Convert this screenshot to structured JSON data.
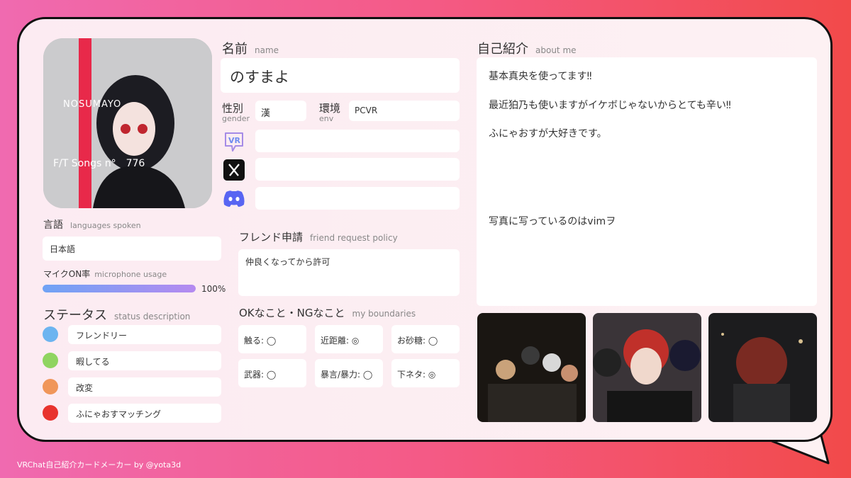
{
  "profile": {
    "name_label": "名前",
    "name_sub": "name",
    "name_value": "のすまよ",
    "gender_label": "性別",
    "gender_sub": "gender",
    "gender_value": "漢",
    "env_label": "環境",
    "env_sub": "env",
    "env_value": "PCVR",
    "avatar_caption_top": "NOSUMAYO",
    "avatar_caption_bottom": "F/T Songs n°　776"
  },
  "social": {
    "vrchat_icon": "vrchat-icon",
    "x_icon": "x-icon",
    "discord_icon": "discord-icon",
    "vrchat_value": "",
    "x_value": "",
    "discord_value": ""
  },
  "languages": {
    "label": "言語",
    "sub": "languages spoken",
    "value": "日本語"
  },
  "mic": {
    "label": "マイクON率",
    "sub": "microphone usage",
    "percent": 100,
    "percent_text": "100%"
  },
  "status": {
    "label": "ステータス",
    "sub": "status description",
    "items": [
      {
        "color": "#6cb4f0",
        "text": "フレンドリー"
      },
      {
        "color": "#8fd460",
        "text": "暇してる"
      },
      {
        "color": "#f0965a",
        "text": "改変"
      },
      {
        "color": "#e8332e",
        "text": "ふにゃおすマッチング"
      }
    ]
  },
  "friend": {
    "label": "フレンド申請",
    "sub": "friend request policy",
    "value": "仲良くなってから許可"
  },
  "boundaries": {
    "label": "OKなこと・NGなこと",
    "sub": "my boundaries",
    "items": [
      "触る: ◯",
      "近距離: ◎",
      "お砂糖: ◯",
      "武器: ◯",
      "暴言/暴力: ◯",
      "下ネタ: ◎"
    ]
  },
  "about": {
    "label": "自己紹介",
    "sub": "about me",
    "lines": [
      "基本真央を使ってます‼",
      "最近狛乃も使いますがイケボじゃないからとても辛い‼",
      "ふにゃおすが大好きです。",
      "写真に写っているのはvimヲ"
    ]
  },
  "footer": "VRChat自己紹介カードメーカー by @yota3d",
  "colors": {
    "accent_red": "#e8294a",
    "bar_start": "#6fa3f5",
    "bar_end": "#b58af0"
  }
}
